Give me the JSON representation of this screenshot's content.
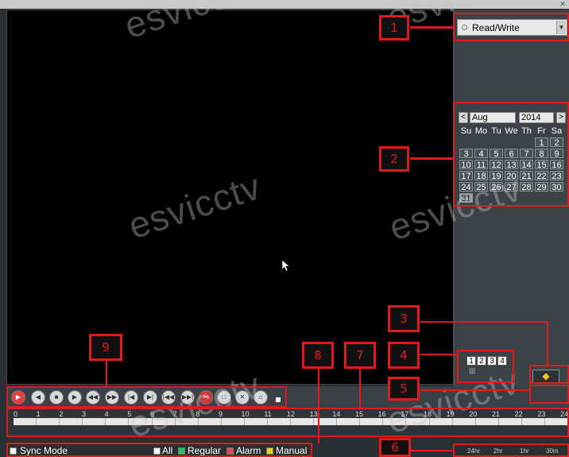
{
  "playback_mode": {
    "selected": "Read/Write"
  },
  "calendar": {
    "month": "Aug",
    "year": "2014",
    "prev": "<",
    "next": ">",
    "weekdays": [
      "Su",
      "Mo",
      "Tu",
      "We",
      "Th",
      "Fr",
      "Sa"
    ],
    "days": [
      "1",
      "2",
      "3",
      "4",
      "5",
      "6",
      "7",
      "8",
      "9",
      "10",
      "11",
      "12",
      "13",
      "14",
      "15",
      "16",
      "17",
      "18",
      "19",
      "20",
      "21",
      "22",
      "23",
      "24",
      "25",
      "26",
      "27",
      "28",
      "29",
      "30",
      "31"
    ],
    "selected_day": "31"
  },
  "channels": [
    "1",
    "2",
    "3",
    "4"
  ],
  "timeline": {
    "hours": [
      "0",
      "1",
      "2",
      "3",
      "4",
      "5",
      "6",
      "7",
      "8",
      "9",
      "10",
      "11",
      "12",
      "13",
      "14",
      "15",
      "16",
      "17",
      "18",
      "19",
      "20",
      "21",
      "22",
      "23",
      "24"
    ]
  },
  "filters": {
    "sync_mode": "Sync Mode",
    "all": "All",
    "regular": "Regular",
    "alarm": "Alarm",
    "manual": "Manual"
  },
  "zoom_levels": [
    "24hr",
    "2hr",
    "1hr",
    "30m"
  ],
  "callouts": [
    "1",
    "2",
    "3",
    "4",
    "5",
    "6",
    "7",
    "8",
    "9"
  ],
  "watermark": "esvicctv",
  "colors": {
    "callout_red": "#e01b1b",
    "regular_green": "#22c55e",
    "alarm_red": "#ef4444",
    "manual_yellow": "#facc15"
  }
}
